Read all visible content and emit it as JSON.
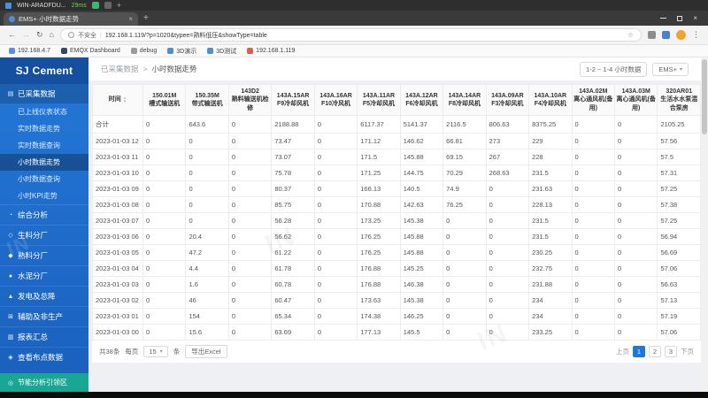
{
  "watermark": "IN",
  "vm_bar": {
    "title": "WIN-ARADFDU...",
    "latency": "29ms"
  },
  "browser": {
    "tab_title": "EMS+·小时数据走势",
    "tab_close": "×",
    "new_tab": "+",
    "window_close": "×",
    "back": "←",
    "forward": "→",
    "reload": "↻",
    "home": "⌂",
    "security_label": "不安全",
    "url": "192.168.1.119/?p=1020&typee=熟料低压&showType=table",
    "star": "☆",
    "menu": "⋮",
    "bookmarks": [
      {
        "label": "192.168.4.7",
        "color": "#5b8def"
      },
      {
        "label": "EMQX Dashboard",
        "color": "#34495e"
      },
      {
        "label": "debug",
        "color": "#9b9b9b"
      },
      {
        "label": "3D演示",
        "color": "#4a90d9"
      },
      {
        "label": "3D测试",
        "color": "#4a90d9"
      },
      {
        "label": "192.168.1.119",
        "color": "#e05d44"
      }
    ]
  },
  "sidebar": {
    "logo": "SJ Cement",
    "group": {
      "label": "已采集数据",
      "icon": "database-icon",
      "items": [
        {
          "label": "已上线仪表状态",
          "active": false
        },
        {
          "label": "实时数据走势",
          "active": false
        },
        {
          "label": "实时数据查询",
          "active": false
        },
        {
          "label": "小时数据走势",
          "active": true
        },
        {
          "label": "小时数据查询",
          "active": false
        },
        {
          "label": "小时KPI走势",
          "active": false
        }
      ]
    },
    "sections": [
      {
        "label": "综合分析",
        "icon": "analysis-icon"
      },
      {
        "label": "生料分厂",
        "icon": "raw-mill-icon"
      },
      {
        "label": "熟料分厂",
        "icon": "clinker-icon"
      },
      {
        "label": "水泥分厂",
        "icon": "cement-icon"
      },
      {
        "label": "发电及总降",
        "icon": "power-icon"
      },
      {
        "label": "辅助及非生产",
        "icon": "auxiliary-icon"
      },
      {
        "label": "报表汇总",
        "icon": "report-icon"
      },
      {
        "label": "查看布点数据",
        "icon": "map-icon"
      }
    ],
    "bottom": {
      "label": "节能分析引领区",
      "icon": "energy-icon"
    }
  },
  "header": {
    "breadcrumb_root": "已采集数据",
    "breadcrumb_sep": ">",
    "breadcrumb_current": "小时数据走势",
    "range_label": "1-2 ~ 1-4 小时数据",
    "source_label": "EMS+"
  },
  "table": {
    "columns": [
      {
        "code": "",
        "name": "时间"
      },
      {
        "code": "150.01M",
        "name": "槽式输送机"
      },
      {
        "code": "150.35M",
        "name": "带式输送机"
      },
      {
        "code": "143D2",
        "name": "熟料输送机检修"
      },
      {
        "code": "143A.15AR",
        "name": "F9冷却风机"
      },
      {
        "code": "143A.16AR",
        "name": "F10冷风机"
      },
      {
        "code": "143A.11AR",
        "name": "F5冷却风机"
      },
      {
        "code": "143A.12AR",
        "name": "F6冷却风机"
      },
      {
        "code": "143A.14AR",
        "name": "F8冷却风机"
      },
      {
        "code": "143A.09AR",
        "name": "F3冷却风机"
      },
      {
        "code": "143A.10AR",
        "name": "F4冷却风机"
      },
      {
        "code": "143A.02M",
        "name": "离心通风机(备用)"
      },
      {
        "code": "143A.03M",
        "name": "离心通风机(备用)"
      },
      {
        "code": "320AR01",
        "name": "生活水水泵混合泵房"
      }
    ],
    "rows": [
      {
        "time": "合计",
        "values": [
          "0",
          "643.6",
          "0",
          "2188.88",
          "0",
          "6117.37",
          "5141.37",
          "2116.5",
          "806.63",
          "8375.25",
          "0",
          "0",
          "2105.25"
        ]
      },
      {
        "time": "2023-01-03 12",
        "values": [
          "0",
          "0",
          "0",
          "73.47",
          "0",
          "171.12",
          "146.62",
          "66.81",
          "273",
          "229",
          "0",
          "0",
          "57.56"
        ]
      },
      {
        "time": "2023-01-03 11",
        "values": [
          "0",
          "0",
          "0",
          "73.07",
          "0",
          "171.5",
          "145.88",
          "69.15",
          "267",
          "228",
          "0",
          "0",
          "57.5"
        ]
      },
      {
        "time": "2023-01-03 10",
        "values": [
          "0",
          "0",
          "0",
          "75.78",
          "0",
          "171.25",
          "144.75",
          "70.29",
          "268.63",
          "231.5",
          "0",
          "0",
          "57.31"
        ]
      },
      {
        "time": "2023-01-03 09",
        "values": [
          "0",
          "0",
          "0",
          "80.37",
          "0",
          "166.13",
          "140.5",
          "74.9",
          "0",
          "231.63",
          "0",
          "0",
          "57.25"
        ]
      },
      {
        "time": "2023-01-03 08",
        "values": [
          "0",
          "0",
          "0",
          "85.75",
          "0",
          "170.88",
          "142.63",
          "76.25",
          "0",
          "228.13",
          "0",
          "0",
          "57.38"
        ]
      },
      {
        "time": "2023-01-03 07",
        "values": [
          "0",
          "0",
          "0",
          "56.28",
          "0",
          "173.25",
          "145.38",
          "0",
          "0",
          "231.5",
          "0",
          "0",
          "57.25"
        ]
      },
      {
        "time": "2023-01-03 06",
        "values": [
          "0",
          "20.4",
          "0",
          "56.62",
          "0",
          "176.25",
          "145.88",
          "0",
          "0",
          "231.5",
          "0",
          "0",
          "56.94"
        ]
      },
      {
        "time": "2023-01-03 05",
        "values": [
          "0",
          "47.2",
          "0",
          "61.22",
          "0",
          "176.25",
          "145.88",
          "0",
          "0",
          "230.25",
          "0",
          "0",
          "56.69"
        ]
      },
      {
        "time": "2023-01-03 04",
        "values": [
          "0",
          "4.4",
          "0",
          "61.78",
          "0",
          "176.88",
          "145.25",
          "0",
          "0",
          "232.75",
          "0",
          "0",
          "57.06"
        ]
      },
      {
        "time": "2023-01-03 03",
        "values": [
          "0",
          "1.6",
          "0",
          "60.78",
          "0",
          "176.88",
          "146.38",
          "0",
          "0",
          "231.88",
          "0",
          "0",
          "56.63"
        ]
      },
      {
        "time": "2023-01-03 02",
        "values": [
          "0",
          "46",
          "0",
          "60.47",
          "0",
          "173.63",
          "145.38",
          "0",
          "0",
          "234",
          "0",
          "0",
          "57.13"
        ]
      },
      {
        "time": "2023-01-03 01",
        "values": [
          "0",
          "154",
          "0",
          "65.34",
          "0",
          "174.38",
          "146.25",
          "0",
          "0",
          "234",
          "0",
          "0",
          "57.19"
        ]
      },
      {
        "time": "2023-01-03 00",
        "values": [
          "0",
          "15.6",
          "0",
          "63.69",
          "0",
          "177.13",
          "145.5",
          "0",
          "0",
          "233.25",
          "0",
          "0",
          "57.06"
        ]
      }
    ]
  },
  "footer": {
    "total_label": "共38条",
    "page_size_prefix": "每页",
    "page_size": "15",
    "page_size_suffix": "条",
    "export_label": "导出Excel",
    "prev_label": "上页",
    "pages": [
      "1",
      "2",
      "3"
    ],
    "active_page": "1",
    "next_label": "下页"
  }
}
